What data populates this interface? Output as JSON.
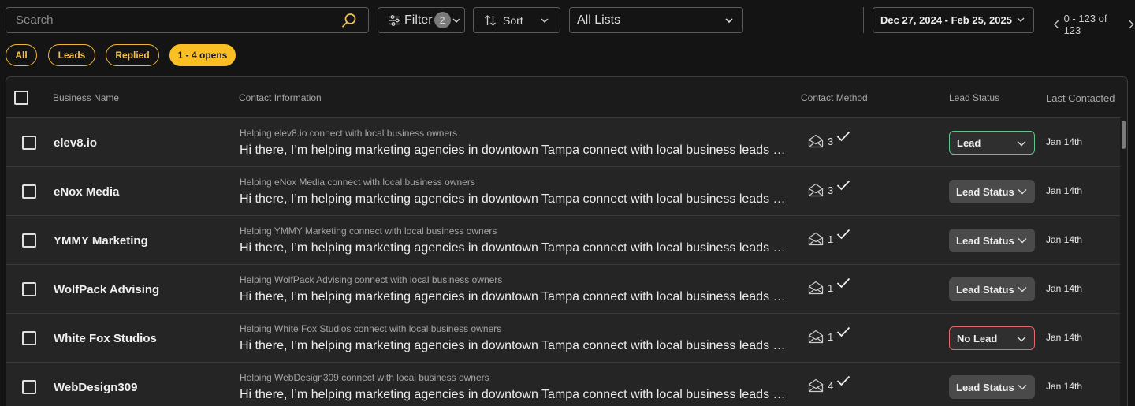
{
  "toolbar": {
    "search_placeholder": "Search",
    "filter_label": "Filter",
    "filter_count": "2",
    "sort_label": "Sort",
    "list_selected": "All Lists",
    "date_range": "Dec 27, 2024 - Feb 25, 2025",
    "pager_text": "0 - 123 of 123"
  },
  "pills": [
    "All",
    "Leads",
    "Replied",
    "1 - 4 opens"
  ],
  "table": {
    "headers": {
      "business": "Business Name",
      "contact": "Contact Information",
      "method": "Contact Method",
      "status": "Lead Status",
      "last": "Last Contacted"
    },
    "rows": [
      {
        "name": "elev8.io",
        "subject": "Helping elev8.io connect with local business owners",
        "message": "Hi there, I’m helping marketing agencies in downtown Tampa connect with local business leads and acquire new clients",
        "count": "3",
        "status": "Lead",
        "date": "Jan 14th"
      },
      {
        "name": "eNox Media",
        "subject": "Helping eNox Media connect with local business owners",
        "message": "Hi there, I’m helping marketing agencies in downtown Tampa connect with local business leads and acquire new clients",
        "count": "3",
        "status": "Lead Status",
        "date": "Jan 14th"
      },
      {
        "name": "YMMY Marketing",
        "subject": "Helping YMMY Marketing connect with local business owners",
        "message": "Hi there, I’m helping marketing agencies in downtown Tampa connect with local business leads and acquire new clients",
        "count": "1",
        "status": "Lead Status",
        "date": "Jan 14th"
      },
      {
        "name": "WolfPack Advising",
        "subject": "Helping WolfPack Advising connect with local business owners",
        "message": "Hi there, I’m helping marketing agencies in downtown Tampa connect with local business leads and acquire new clients",
        "count": "1",
        "status": "Lead Status",
        "date": "Jan 14th"
      },
      {
        "name": "White Fox Studios",
        "subject": "Helping White Fox Studios connect with local business owners",
        "message": "Hi there, I’m helping marketing agencies in downtown Tampa connect with local business leads and acquire new clients",
        "count": "1",
        "status": "No Lead",
        "date": "Jan 14th"
      },
      {
        "name": "WebDesign309",
        "subject": "Helping WebDesign309 connect with local business owners",
        "message": "Hi there, I’m helping marketing agencies in downtown Tampa connect with local business leads and acquire new clients",
        "count": "4",
        "status": "Lead Status",
        "date": "Jan 14th"
      }
    ]
  },
  "colors": {
    "accent": "#fbbf24",
    "lead_border": "#5fc48a",
    "no_lead_border": "#e26a6a"
  }
}
